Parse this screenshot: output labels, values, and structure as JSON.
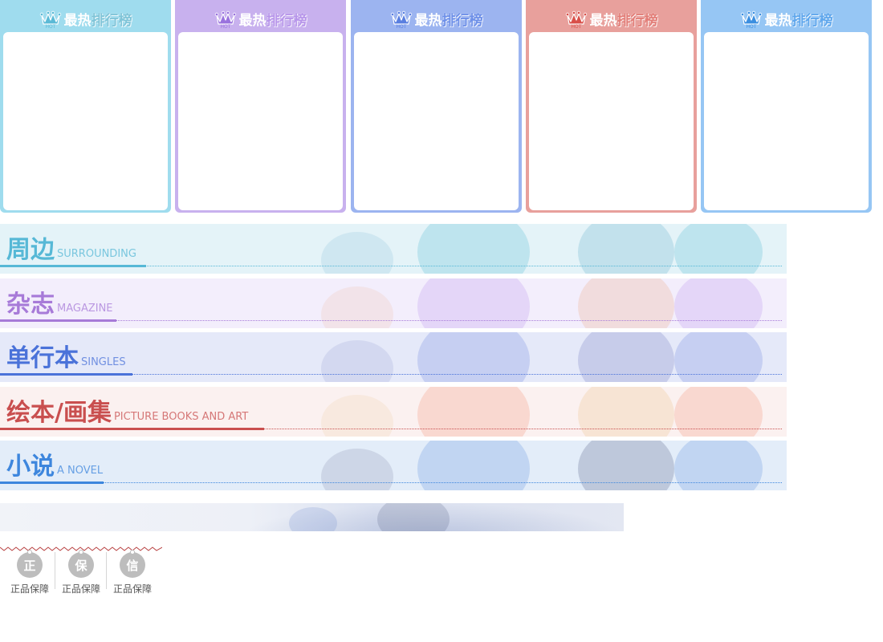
{
  "ranking_panels": [
    {
      "title_a": "最热",
      "title_b": "排行榜",
      "badge": "HOT",
      "color": "#9fdcee",
      "accent": "#5bbad6",
      "title_b_color": "#7fc4d8"
    },
    {
      "title_a": "最热",
      "title_b": "排行榜",
      "badge": "HOT",
      "color": "#c8b1ee",
      "accent": "#9a73de",
      "title_b_color": "#b795ea"
    },
    {
      "title_a": "最热",
      "title_b": "排行榜",
      "badge": "HOT",
      "color": "#9cb4f0",
      "accent": "#5a7fe0",
      "title_b_color": "#6d8fe8"
    },
    {
      "title_a": "最热",
      "title_b": "排行榜",
      "badge": "HOT",
      "color": "#e8a09c",
      "accent": "#d9504a",
      "title_b_color": "#e27d77"
    },
    {
      "title_a": "最热",
      "title_b": "排行榜",
      "badge": "HOT",
      "color": "#96c6f4",
      "accent": "#3c8fe0",
      "title_b_color": "#5ea6ec"
    }
  ],
  "categories": [
    {
      "title": "周边",
      "subtitle": "SURROUNDING",
      "color": "#56b8d6",
      "bg": "#e4f3f8",
      "underline_width": 182
    },
    {
      "title": "杂志",
      "subtitle": "MAGAZINE",
      "color": "#a77ad8",
      "bg": "#f3eefc",
      "underline_width": 145
    },
    {
      "title": "单行本",
      "subtitle": "SINGLES",
      "color": "#4a72d9",
      "bg": "#e5e9f9",
      "underline_width": 165
    },
    {
      "title": "绘本/画集",
      "subtitle": "PICTURE BOOKS AND ART",
      "color": "#c94f4f",
      "bg": "#fbf1f0",
      "underline_width": 329
    },
    {
      "title": "小说",
      "subtitle": "A NOVEL",
      "color": "#3d86dd",
      "bg": "#e3edf9",
      "underline_width": 129
    }
  ],
  "guarantees": [
    {
      "glyph": "正",
      "label": "正品保障"
    },
    {
      "glyph": "保",
      "label": "正品保障"
    },
    {
      "glyph": "信",
      "label": "正品保障"
    }
  ]
}
